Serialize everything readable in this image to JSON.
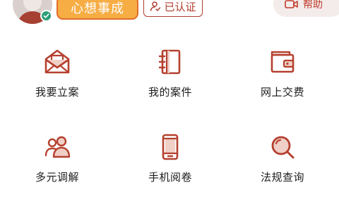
{
  "header": {
    "slogan": "心想事成",
    "certified_label": "已认证",
    "help_label": "帮助"
  },
  "grid": [
    {
      "label": "我要立案",
      "icon": "envelope-icon"
    },
    {
      "label": "我的案件",
      "icon": "notebook-icon"
    },
    {
      "label": "网上交费",
      "icon": "wallet-icon"
    },
    {
      "label": "多元调解",
      "icon": "people-icon"
    },
    {
      "label": "手机阅卷",
      "icon": "phone-icon"
    },
    {
      "label": "法规查询",
      "icon": "search-icon"
    }
  ],
  "colors": {
    "accent": "#b03e2e",
    "icon_stroke": "#b5402f",
    "icon_light": "#f0cfc6",
    "slogan_bg": "#f6ad44",
    "help_bg": "#f4ecea",
    "verified": "#2e9f79"
  }
}
